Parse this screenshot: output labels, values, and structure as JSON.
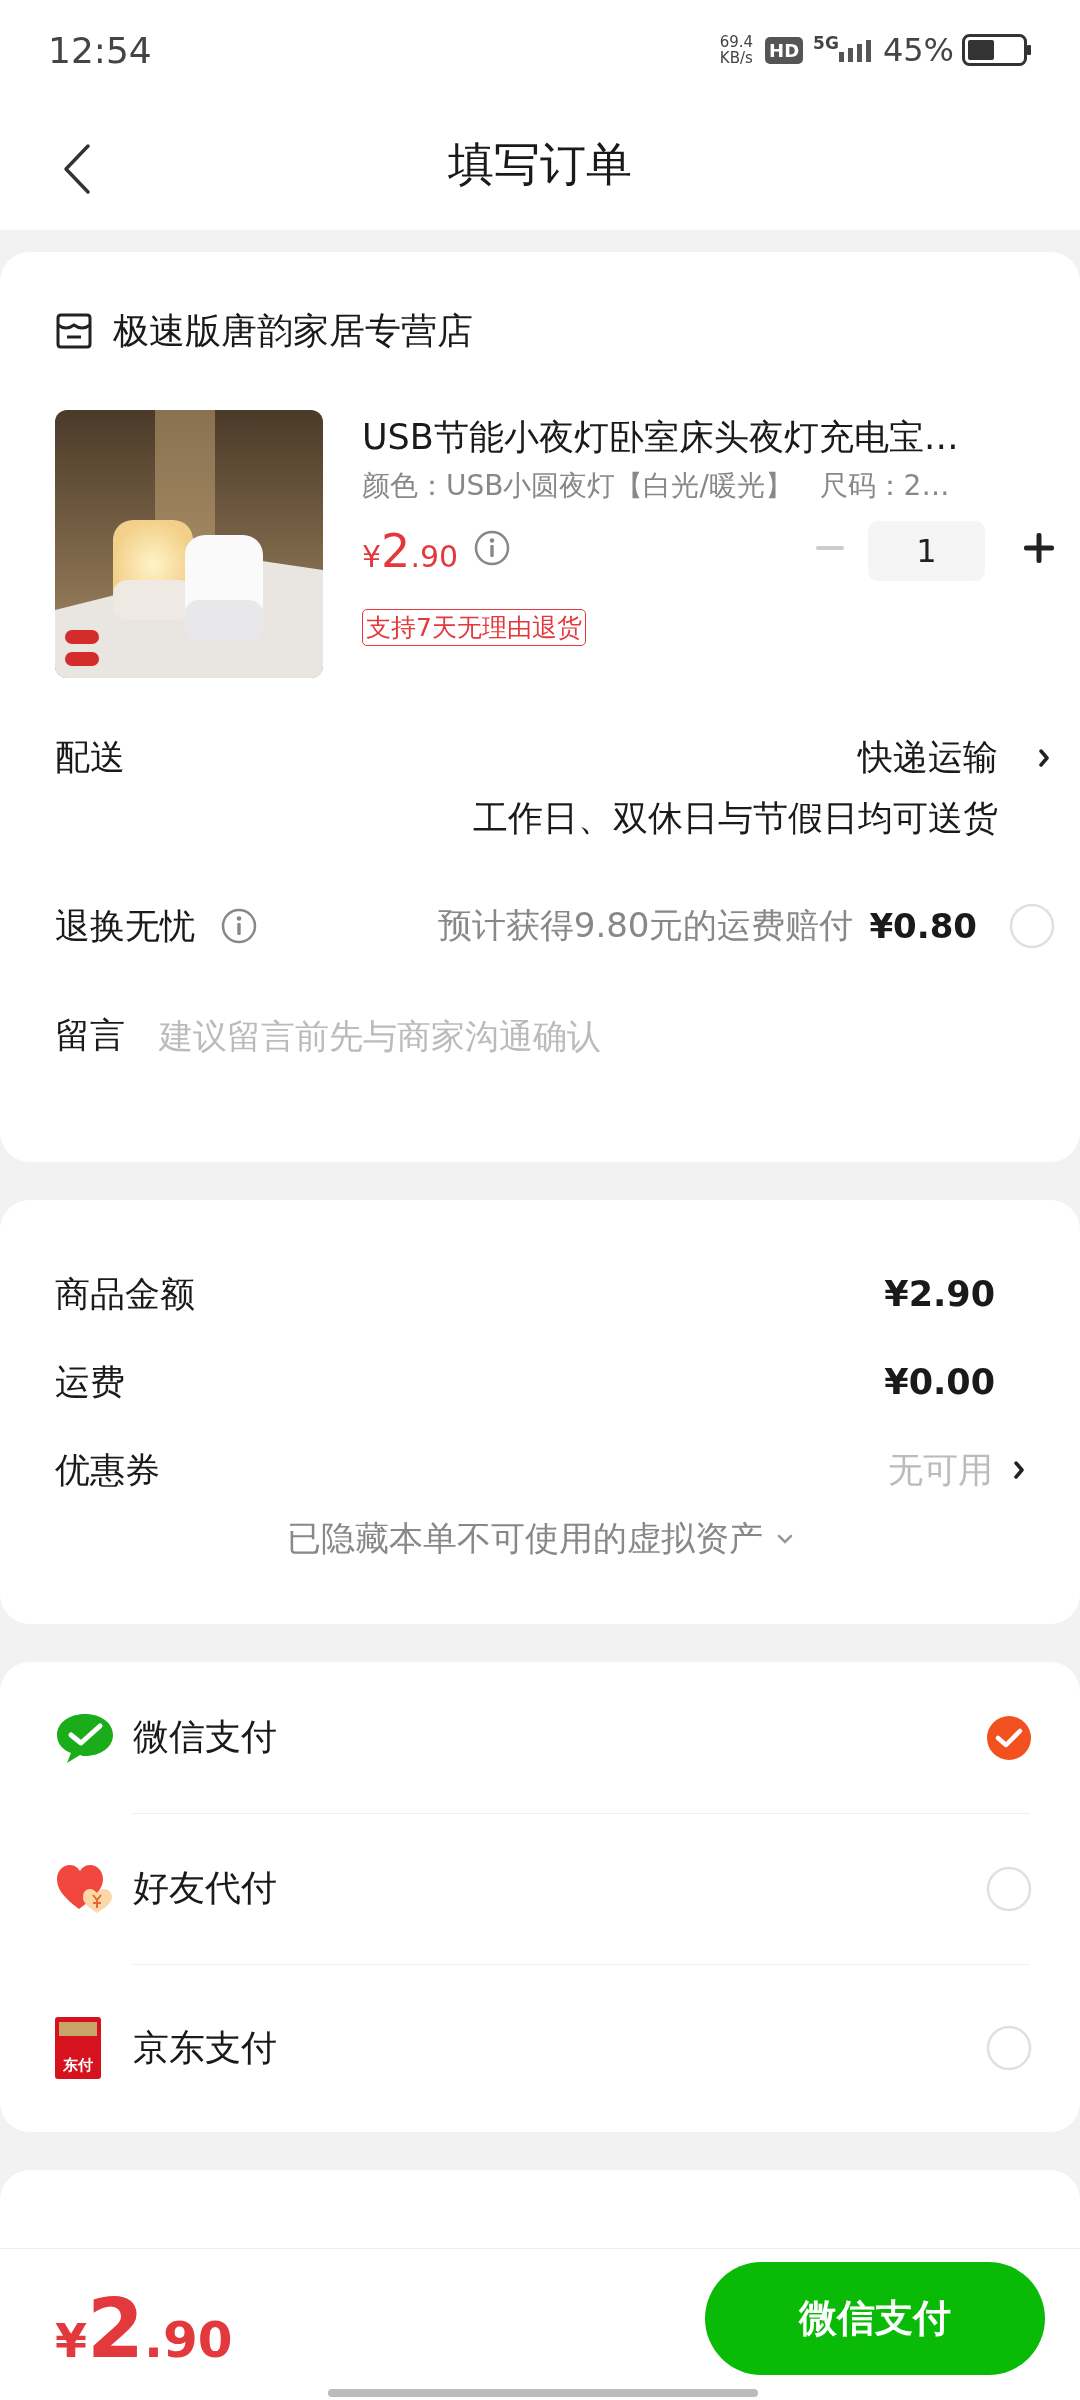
{
  "status_bar": {
    "time": "12:54",
    "net_speed": "69.4",
    "net_unit": "KB/s",
    "hd": "HD",
    "network": "5G",
    "battery": "45%"
  },
  "nav": {
    "title": "填写订单"
  },
  "store": {
    "name": "极速版唐韵家居专营店"
  },
  "product": {
    "kind": "picture",
    "title": "USB节能小夜灯卧室床头夜灯充电宝…",
    "spec": "颜色：USB小圆夜灯【白光/暖光】   尺码：2…",
    "price": {
      "currency": "¥",
      "integer": "2",
      "decimal": ".90"
    },
    "quantity": "1",
    "minus_disabled": true,
    "tag": "支持7天无理由退货"
  },
  "delivery": {
    "label": "配送",
    "value": "快递运输",
    "note": "工作日、双休日与节假日均可送货"
  },
  "insurance": {
    "label": "退换无忧",
    "text": "预计获得9.80元的运费赔付",
    "price": "¥0.80",
    "checked": false
  },
  "message": {
    "label": "留言",
    "placeholder": "建议留言前先与商家沟通确认"
  },
  "summary": {
    "rows": [
      {
        "kind": "amount",
        "label": "商品金额",
        "value": "¥2.90"
      },
      {
        "kind": "amount",
        "label": "运费",
        "value": "¥0.00"
      },
      {
        "kind": "link",
        "label": "优惠券",
        "value": "无可用"
      }
    ],
    "hidden_note": "已隐藏本单不可使用的虚拟资产"
  },
  "payment": [
    {
      "kind": "wechat",
      "label": "微信支付",
      "selected": true
    },
    {
      "kind": "friend",
      "label": "好友代付",
      "selected": false
    },
    {
      "kind": "card",
      "label": "京东支付",
      "icon_text": "东付",
      "selected": false
    }
  ],
  "bottom": {
    "total": {
      "currency": "¥",
      "integer": "2",
      "decimal": ".90"
    },
    "button": "微信支付"
  }
}
